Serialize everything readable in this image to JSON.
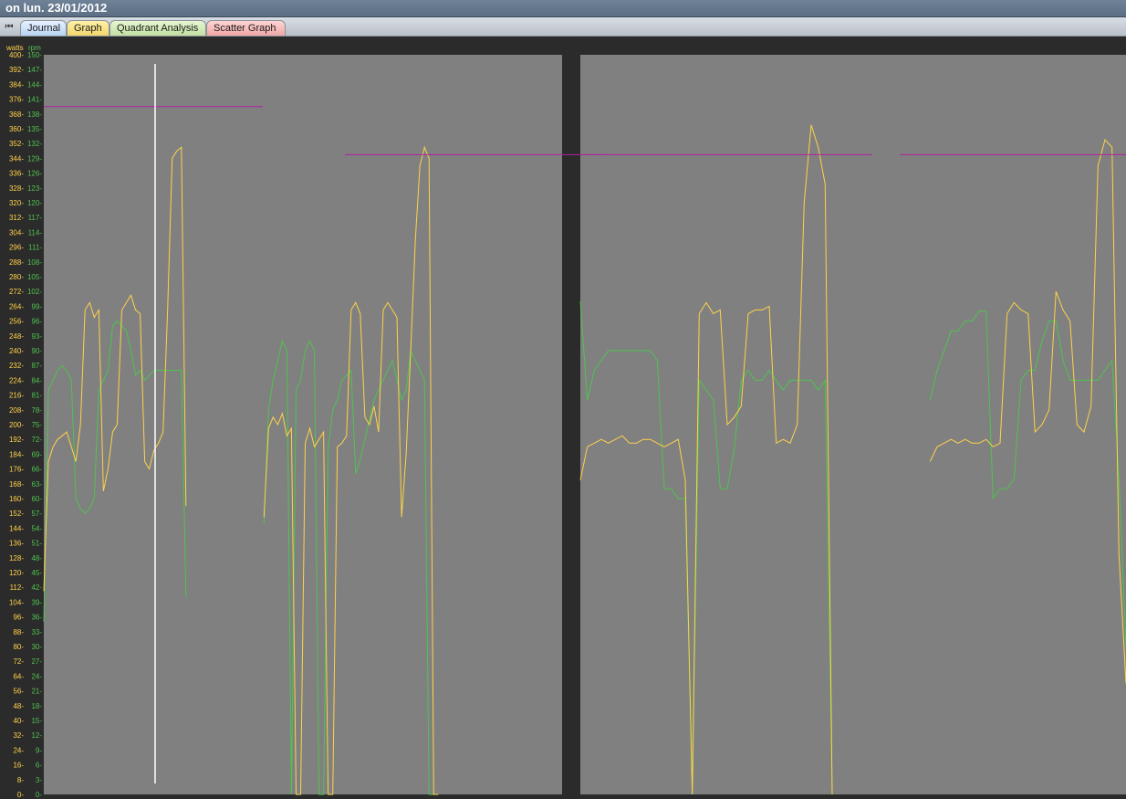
{
  "window": {
    "title": "on lun. 23/01/2012"
  },
  "tabs": [
    {
      "label": "Journal"
    },
    {
      "label": "Graph"
    },
    {
      "label": "Quadrant Analysis"
    },
    {
      "label": "Scatter Graph"
    }
  ],
  "colors": {
    "power": "#ffd24a",
    "cadence": "#4fc34f",
    "target": "#b0209f",
    "cursor": "#ffffff",
    "plot_bg": "#808080",
    "frame_bg": "#2b2b2b"
  },
  "chart_data": {
    "type": "line",
    "ylabel": "watts",
    "y2label": "rpm",
    "ylim": [
      0,
      400
    ],
    "y2lim": [
      0,
      150
    ],
    "yticks": [
      "400",
      "392",
      "384",
      "376",
      "368",
      "360",
      "352",
      "344",
      "336",
      "328",
      "320",
      "312",
      "304",
      "296",
      "288",
      "280",
      "272",
      "264",
      "256",
      "248",
      "240",
      "232",
      "224",
      "216",
      "208",
      "200",
      "192",
      "184",
      "176",
      "168",
      "160",
      "152",
      "144",
      "136",
      "128",
      "120",
      "112",
      "104",
      "96",
      "88",
      "80",
      "72",
      "64",
      "56",
      "48",
      "40",
      "32",
      "24",
      "16",
      "8",
      "0"
    ],
    "y2ticks": [
      "150",
      "147",
      "144",
      "141",
      "138",
      "135",
      "132",
      "129",
      "126",
      "123",
      "120",
      "117",
      "114",
      "111",
      "108",
      "105",
      "102",
      "99",
      "96",
      "93",
      "90",
      "87",
      "84",
      "81",
      "78",
      "75",
      "72",
      "69",
      "66",
      "63",
      "60",
      "57",
      "54",
      "51",
      "48",
      "45",
      "42",
      "39",
      "36",
      "33",
      "30",
      "27",
      "24",
      "21",
      "18",
      "15",
      "12",
      "9",
      "6",
      "3",
      "0"
    ],
    "x": [
      0,
      10,
      20,
      30,
      40,
      50,
      60,
      70,
      80,
      90,
      100,
      110,
      120,
      130,
      140,
      150,
      160,
      170,
      180,
      190,
      200,
      210,
      220,
      230,
      240,
      250,
      260,
      270,
      280,
      290,
      300,
      310,
      320,
      330,
      340,
      350,
      360,
      370,
      380,
      390,
      400,
      410,
      420,
      430,
      440,
      450,
      460,
      470,
      480,
      490,
      500,
      510,
      520,
      530,
      540,
      550,
      560,
      570,
      580,
      590,
      600,
      610,
      620,
      630,
      640,
      650,
      660,
      670,
      680,
      690,
      700,
      710,
      720,
      730,
      740,
      750,
      760,
      770,
      780,
      790,
      800,
      810,
      820,
      830,
      840,
      850,
      860,
      870,
      880,
      890,
      900,
      910,
      920,
      930,
      940,
      950,
      960,
      970,
      980,
      990,
      1000,
      1010,
      1020,
      1030,
      1040,
      1050,
      1060,
      1070,
      1080,
      1090,
      1100,
      1110,
      1120,
      1130
    ],
    "series": [
      {
        "name": "watts",
        "axis": "left",
        "values": [
          110,
          180,
          188,
          192,
          194,
          196,
          188,
          180,
          200,
          262,
          266,
          258,
          262,
          164,
          176,
          196,
          200,
          262,
          266,
          270,
          262,
          260,
          180,
          176,
          186,
          190,
          196,
          262,
          344,
          348,
          350,
          156,
          null,
          null,
          null,
          null,
          null,
          null,
          null,
          null,
          null,
          null,
          null,
          null,
          null,
          null,
          null,
          null,
          150,
          198,
          204,
          200,
          206,
          194,
          198,
          0,
          0,
          190,
          198,
          188,
          192,
          196,
          0,
          0,
          188,
          190,
          194,
          262,
          266,
          260,
          204,
          200,
          210,
          196,
          262,
          266,
          262,
          258,
          150,
          184,
          240,
          300,
          340,
          350,
          344,
          0,
          0,
          null,
          null,
          null,
          null,
          null,
          null,
          null,
          null,
          null,
          null,
          null,
          null,
          null,
          null,
          null,
          null,
          null,
          null,
          null,
          null,
          null,
          null,
          null,
          null,
          null,
          null,
          null
        ]
      },
      {
        "name": "rpm",
        "axis": "right",
        "values": [
          35,
          82,
          84,
          86,
          87,
          86,
          84,
          60,
          58,
          57,
          58,
          60,
          82,
          84,
          86,
          95,
          96,
          95,
          94,
          90,
          85,
          86,
          84,
          85,
          86,
          86,
          86,
          86,
          86,
          86,
          86,
          40,
          null,
          null,
          null,
          null,
          null,
          null,
          null,
          null,
          null,
          null,
          null,
          null,
          null,
          null,
          null,
          null,
          55,
          78,
          84,
          88,
          92,
          90,
          0,
          82,
          84,
          90,
          92,
          90,
          0,
          0,
          70,
          78,
          80,
          84,
          85,
          86,
          65,
          68,
          72,
          76,
          80,
          82,
          84,
          86,
          88,
          84,
          80,
          82,
          90,
          88,
          86,
          84,
          0,
          0,
          null,
          null,
          null,
          null,
          null,
          null,
          null,
          null,
          null,
          null,
          null,
          null,
          null,
          null,
          null,
          null,
          null,
          null,
          null,
          null,
          null,
          null,
          null,
          null,
          null,
          null,
          null,
          null
        ]
      }
    ],
    "panel2": {
      "watts": [
        170,
        188,
        190,
        192,
        190,
        192,
        194,
        190,
        190,
        192,
        192,
        190,
        188,
        190,
        192,
        170,
        0,
        260,
        266,
        260,
        262,
        200,
        204,
        210,
        260,
        262,
        262,
        264,
        190,
        192,
        190,
        200,
        320,
        362,
        350,
        330,
        0,
        null,
        null,
        null,
        null,
        null,
        null,
        null,
        null,
        null,
        null,
        null,
        null,
        null,
        180,
        188,
        190,
        192,
        190,
        192,
        190,
        190,
        192,
        188,
        190,
        260,
        266,
        262,
        260,
        196,
        200,
        208,
        272,
        262,
        256,
        200,
        196,
        210,
        340,
        354,
        350,
        130,
        60
      ],
      "rpm": [
        100,
        80,
        86,
        88,
        90,
        90,
        90,
        90,
        90,
        90,
        90,
        88,
        62,
        62,
        60,
        60,
        0,
        84,
        82,
        80,
        62,
        62,
        70,
        84,
        86,
        84,
        84,
        86,
        84,
        82,
        84,
        84,
        84,
        84,
        82,
        84,
        0,
        null,
        null,
        null,
        null,
        null,
        null,
        null,
        null,
        null,
        null,
        null,
        null,
        null,
        80,
        86,
        90,
        94,
        94,
        96,
        96,
        98,
        98,
        60,
        62,
        62,
        64,
        84,
        86,
        86,
        92,
        96,
        96,
        88,
        84,
        84,
        84,
        84,
        84,
        86,
        88,
        64,
        30
      ]
    },
    "targets": [
      {
        "panel": 1,
        "watts": 372,
        "x_range": [
          0,
          240
        ]
      },
      {
        "panel": 1,
        "watts": 346,
        "x_range": [
          330,
          615
        ]
      },
      {
        "panel": 2,
        "watts": 346,
        "x_range": [
          0,
          320
        ]
      },
      {
        "panel": 2,
        "watts": 346,
        "x_range": [
          350,
          600
        ]
      }
    ],
    "grid": false,
    "legend": "none"
  }
}
